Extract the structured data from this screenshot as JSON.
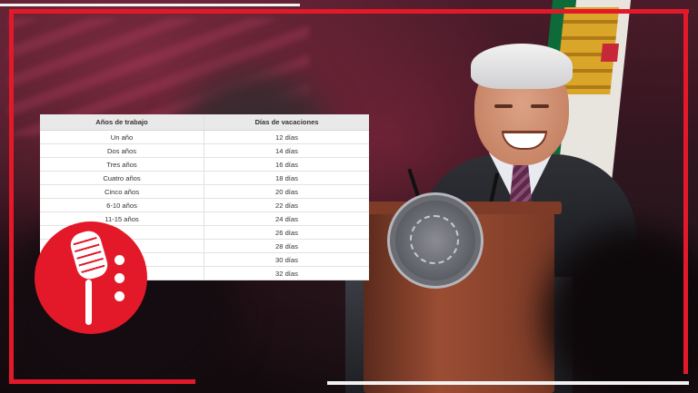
{
  "table": {
    "headers": [
      "Años de trabajo",
      "Días de vacaciones"
    ],
    "rows": [
      [
        "Un año",
        "12 días"
      ],
      [
        "Dos años",
        "14 días"
      ],
      [
        "Tres años",
        "16 días"
      ],
      [
        "Cuatro años",
        "18 días"
      ],
      [
        "Cinco años",
        "20 días"
      ],
      [
        "6-10 años",
        "22 días"
      ],
      [
        "11-15 años",
        "24 días"
      ],
      [
        "",
        "26 días"
      ],
      [
        "",
        "28 días"
      ],
      [
        "",
        "30 días"
      ],
      [
        "",
        "32 días"
      ]
    ]
  },
  "colors": {
    "frame": "#e3192a",
    "logo_bg": "#e3192a",
    "table_header_bg": "#e9e9e9"
  },
  "icons": {
    "logo": "microphone-icon"
  }
}
